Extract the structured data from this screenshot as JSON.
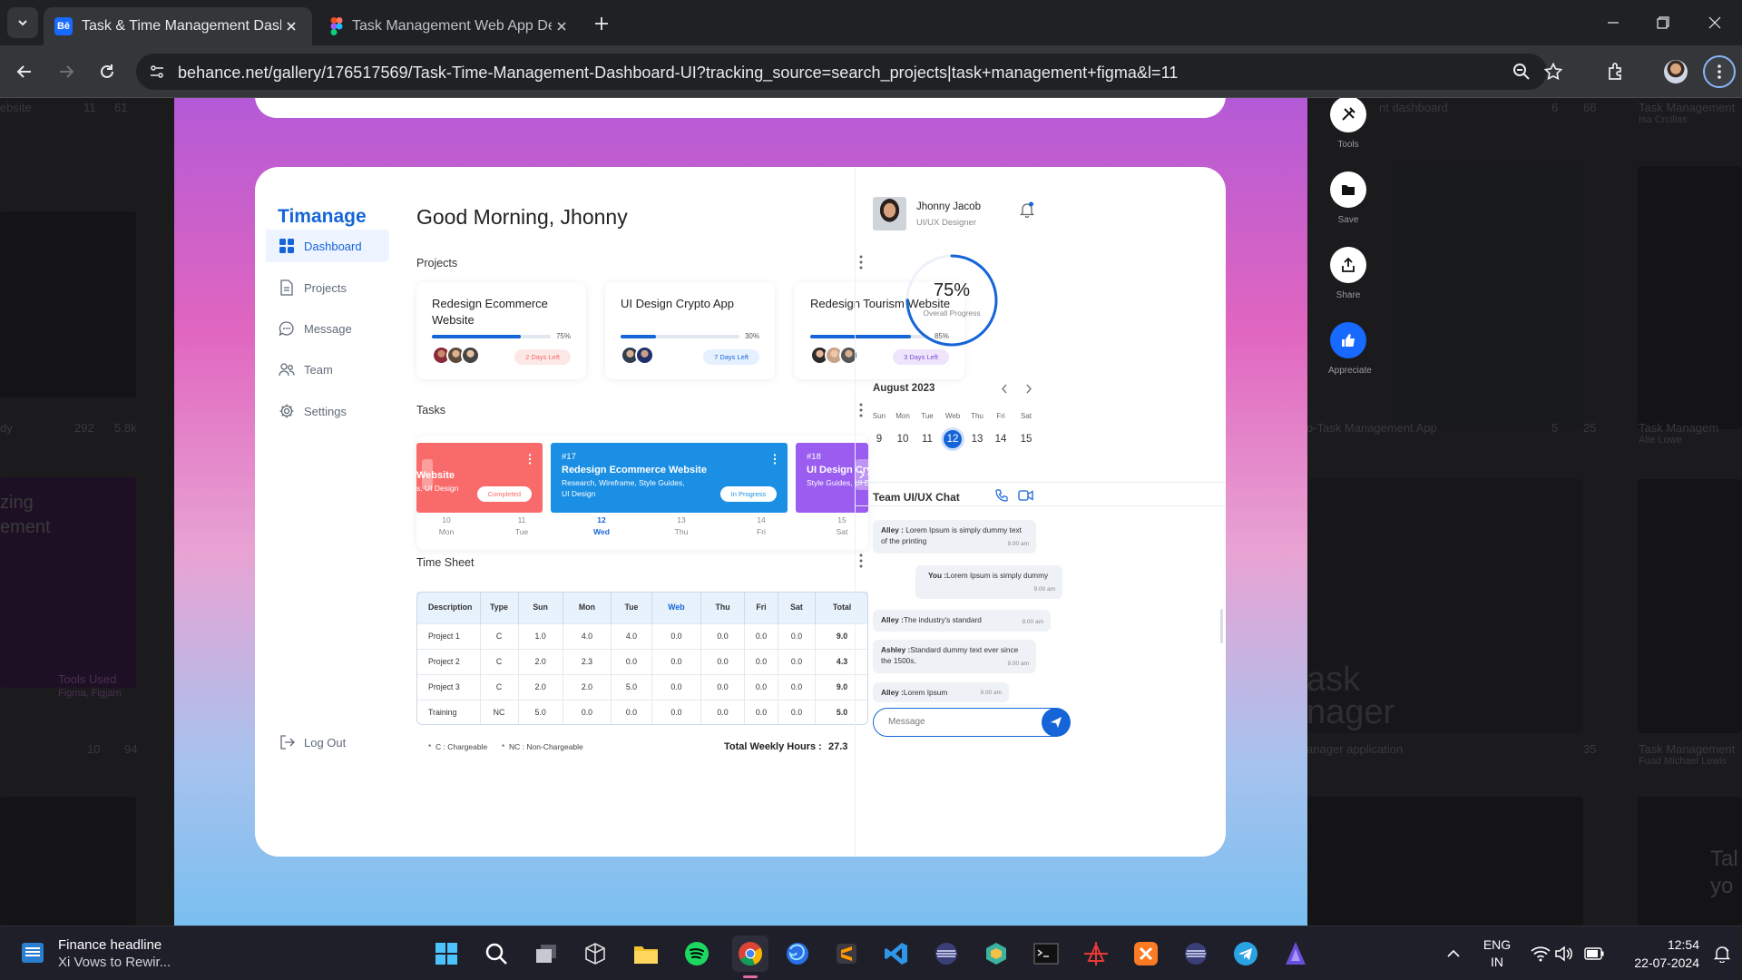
{
  "browser": {
    "tabs": [
      {
        "title": "Task & Time Management Dash",
        "favicon": "Bē"
      },
      {
        "title": "Task Management Web App De"
      }
    ],
    "url": "behance.net/gallery/176517569/Task-Time-Management-Dashboard-UI?tracking_source=search_projects|task+management+figma&l=11"
  },
  "background_gallery": {
    "texts": [
      "ebsite",
      "11",
      "61",
      "dy",
      "292",
      "5.8k",
      "zing",
      "ement",
      "Tools Used",
      "Figma, Figjam",
      "10",
      "94",
      "nt dashboard",
      "6",
      "66",
      "Task Management",
      "Isa Crcillas",
      "o-Task Management App",
      "5",
      "25",
      "Task Managem",
      "Alie Lowe",
      "ask",
      "nager",
      "anager application",
      "35",
      "Task Management",
      "Fuad Michael Lewis",
      "Tal",
      "yo"
    ]
  },
  "behance_tools": [
    {
      "label": "Tools",
      "icon": "tools-icon"
    },
    {
      "label": "Save",
      "icon": "folder-icon"
    },
    {
      "label": "Share",
      "icon": "share-icon"
    },
    {
      "label": "Appreciate",
      "icon": "thumbs-up-icon"
    }
  ],
  "dashboard": {
    "logo": "Timanage",
    "nav": [
      {
        "label": "Dashboard",
        "icon": "grid-icon",
        "active": true
      },
      {
        "label": "Projects",
        "icon": "document-icon"
      },
      {
        "label": "Message",
        "icon": "chat-icon"
      },
      {
        "label": "Team",
        "icon": "team-icon"
      },
      {
        "label": "Settings",
        "icon": "gear-icon"
      }
    ],
    "logout": "Log Out",
    "greeting": "Good Morning, Jhonny",
    "projects_title": "Projects",
    "projects": [
      {
        "title": "Redesign Ecommerce Website",
        "progress_label": "75%",
        "progress": 0.75,
        "badge": "2 Days Left",
        "badge_color": "#f36a6a",
        "badge_bg": "#fde8e8"
      },
      {
        "title": "UI Design Crypto  App",
        "progress_label": "30%",
        "progress": 0.3,
        "badge": "7 Days Left",
        "badge_color": "#1565d8",
        "badge_bg": "#e6f1ff"
      },
      {
        "title": "Redesign Tourism Website",
        "progress_label": "85%",
        "progress": 0.85,
        "badge": "3 Days Left",
        "badge_color": "#7a4fd6",
        "badge_bg": "#eee4fb"
      }
    ],
    "tasks_title": "Tasks",
    "tasks": [
      {
        "number": "",
        "title": "Website",
        "sub": "s, UI Design",
        "badge": "Completed",
        "color": "#f96b6b"
      },
      {
        "number": "#17",
        "title": "Redesign Ecommerce Website",
        "sub": "Research, Wireframe, Style Guides, UI Design",
        "badge": "In Progress",
        "color": "#1a8fe3"
      },
      {
        "number": "#18",
        "title": "UI Design Cryptocurrency  App",
        "sub": "Style Guides, UI Design",
        "badge": "",
        "color": "#9b5cf0"
      }
    ],
    "task_days": [
      {
        "date": "10",
        "day": "Mon"
      },
      {
        "date": "11",
        "day": "Tue"
      },
      {
        "date": "12",
        "day": "Wed",
        "selected": true
      },
      {
        "date": "13",
        "day": "Thu"
      },
      {
        "date": "14",
        "day": "Fri"
      },
      {
        "date": "15",
        "day": "Sat"
      }
    ],
    "timesheet_title": "Time Sheet",
    "timesheet_headers": [
      "Description",
      "Type",
      "Sun",
      "Mon",
      "Tue",
      "Web",
      "Thu",
      "Fri",
      "Sat",
      "Total"
    ],
    "timesheet_rows": [
      [
        "Project 1",
        "C",
        "1.0",
        "4.0",
        "4.0",
        "0.0",
        "0.0",
        "0.0",
        "0.0",
        "9.0"
      ],
      [
        "Project 2",
        "C",
        "2.0",
        "2.3",
        "0.0",
        "0.0",
        "0.0",
        "0.0",
        "0.0",
        "4.3"
      ],
      [
        "Project 3",
        "C",
        "2.0",
        "2.0",
        "5.0",
        "0.0",
        "0.0",
        "0.0",
        "0.0",
        "9.0"
      ],
      [
        "Training",
        "NC",
        "5.0",
        "0.0",
        "0.0",
        "0.0",
        "0.0",
        "0.0",
        "0.0",
        "5.0"
      ]
    ],
    "legend_c": "C : Chargeable",
    "legend_nc": "NC : Non-Chargeable",
    "total_label": "Total Weekly Hours :",
    "total_value": "27.3",
    "user_name": "Jhonny Jacob",
    "user_role": "UI/UX Designer",
    "overall_value": "75%",
    "overall_fraction": 0.75,
    "overall_label": "Overall Progress",
    "calendar_month": "August 2023",
    "calendar_days": [
      "Sun",
      "Mon",
      "Tue",
      "Web",
      "Thu",
      "Fri",
      "Sat"
    ],
    "calendar_dates": [
      "9",
      "10",
      "11",
      "12",
      "13",
      "14",
      "15"
    ],
    "calendar_selected": "12",
    "chat_title": "Team UI/UX Chat",
    "messages": [
      {
        "sender": "Alley :",
        "text": "Lorem Ipsum is simply dummy text of the printing",
        "time": "9.00 am"
      },
      {
        "sender": "You :",
        "text": "Lorem Ipsum is simply dummy",
        "time": "9.00 am"
      },
      {
        "sender": "Alley :",
        "text": "The industry's standard",
        "time": "9.00 am"
      },
      {
        "sender": "Ashley :",
        "text": "Standard dummy text ever since the 1500s,",
        "time": "9.00 am"
      },
      {
        "sender": "Alley :",
        "text": "Lorem Ipsum",
        "time": "9.00 am"
      }
    ],
    "message_placeholder": "Message"
  },
  "taskbar": {
    "news_title": "Finance headline",
    "news_sub": "Xi Vows to Rewir...",
    "lang1": "ENG",
    "lang2": "IN",
    "time": "12:54",
    "date": "22-07-2024"
  }
}
